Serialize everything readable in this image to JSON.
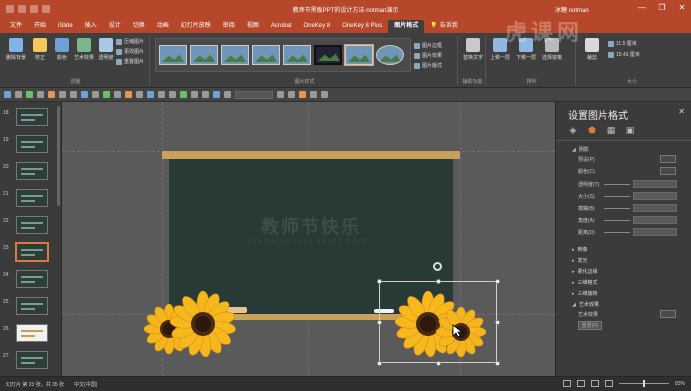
{
  "titlebar": {
    "doc_title": "教师节黑板PPT的设计方法-notman演示",
    "user": "冰糖 notman",
    "minimize": "—",
    "restore": "❐",
    "close": "✕"
  },
  "tabs": [
    "文件",
    "开始",
    "iSlide",
    "插入",
    "设计",
    "切换",
    "动画",
    "幻灯片放映",
    "审阅",
    "视图",
    "Acrobat",
    "OneKey 8",
    "OneKey 8 Plus",
    "图片格式",
    "告诉我"
  ],
  "active_tab": "图片格式",
  "ribbon": {
    "adjust": {
      "remove_bg": "删除背景",
      "corrections": "校正",
      "color": "颜色",
      "artistic": "艺术效果",
      "transparency": "透明度",
      "compress": "压缩图片",
      "change": "更改图片",
      "reset": "重置图片",
      "label": "调整"
    },
    "styles": {
      "label": "图片样式",
      "border": "图片边框",
      "effects": "图片效果",
      "layout": "图片版式"
    },
    "accessibility": {
      "alt_text": "替换文字",
      "label": "辅助功能"
    },
    "arrange": {
      "forward": "上移一层",
      "backward": "下移一层",
      "selection_pane": "选择窗格",
      "label": "排列"
    },
    "size": {
      "crop": "裁剪",
      "height": "11.5 厘米",
      "width": "15.43 厘米",
      "label": "大小"
    }
  },
  "thumbnails": [
    {
      "num": "18",
      "variant": "dark"
    },
    {
      "num": "19",
      "variant": "dark"
    },
    {
      "num": "20",
      "variant": "dark"
    },
    {
      "num": "21",
      "variant": "dark"
    },
    {
      "num": "22",
      "variant": "dark"
    },
    {
      "num": "23",
      "variant": "selected"
    },
    {
      "num": "24",
      "variant": "dark"
    },
    {
      "num": "25",
      "variant": "dark"
    },
    {
      "num": "26",
      "variant": "light"
    },
    {
      "num": "27",
      "variant": "dark"
    }
  ],
  "slide": {
    "title": "教师节快乐",
    "subtitle": "TEACHERS' DAY HAPPY HAPPY"
  },
  "format_pane": {
    "title": "设置图片格式",
    "close": "✕",
    "shadow_section": "阴影",
    "presets_label": "预设(P)",
    "color_label": "颜色(C)",
    "transparency_label": "透明度(T)",
    "size_label": "大小(S)",
    "blur_label": "模糊(B)",
    "angle_label": "角度(A)",
    "distance_label": "距离(D)",
    "reflection_section": "映像",
    "glow_section": "发光",
    "soft_edges_section": "柔化边缘",
    "bevel_section": "三维格式",
    "rotation_section": "三维旋转",
    "artistic_section": "艺术效果",
    "artistic_label": "艺术效果",
    "reset_label": "重置(R)"
  },
  "status": {
    "slide_info": "幻灯片 第 23 张，共 35 张",
    "lang": "中文(中国)",
    "zoom": "83%"
  },
  "watermark": "虎课网"
}
